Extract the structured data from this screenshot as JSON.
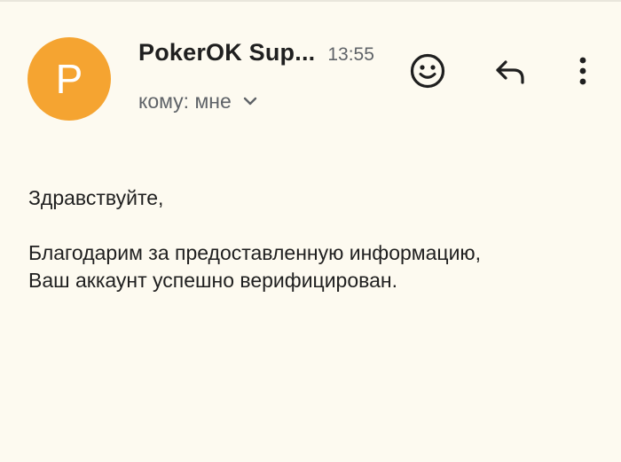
{
  "header": {
    "avatar_letter": "P",
    "sender_name": "PokerOK Sup...",
    "time": "13:55",
    "recipient_label": "кому: мне"
  },
  "icons": {
    "avatar": "avatar",
    "recipient_details": "chevron-down-icon",
    "emoji": "emoji-smile-icon",
    "reply": "reply-icon",
    "more": "more-vert-icon"
  },
  "message": {
    "greeting": "Здравствуйте,",
    "line1": "Благодарим за предоставленную информацию,",
    "line2": "Ваш аккаунт успешно верифицирован."
  },
  "colors": {
    "background": "#fdfaf0",
    "avatar": "#f5a431",
    "text": "#1f1f1f",
    "secondary_text": "#5f6368"
  }
}
